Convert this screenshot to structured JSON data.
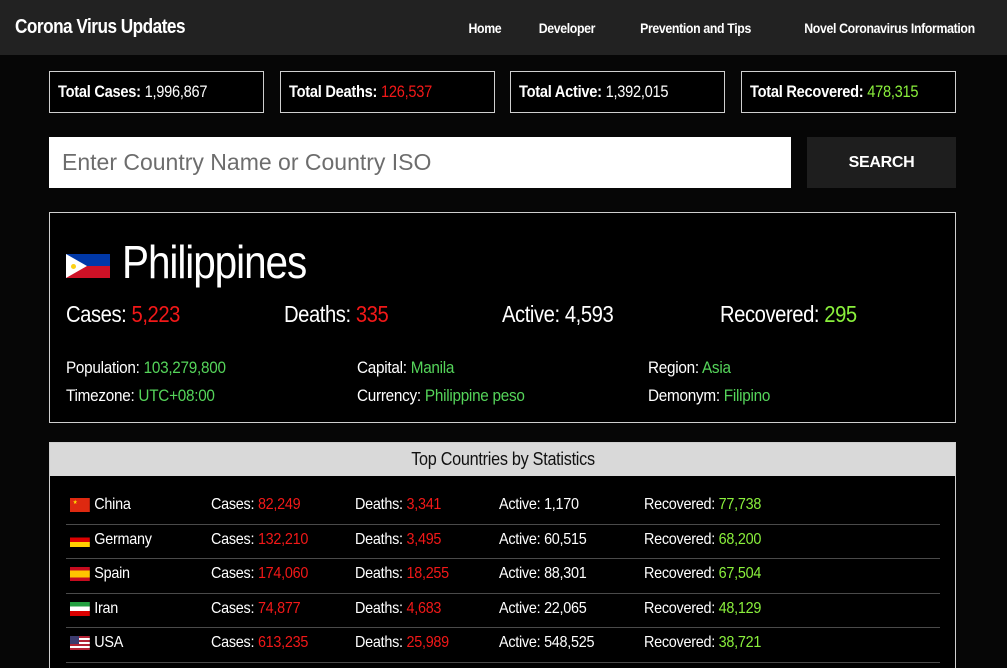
{
  "nav": {
    "brand": "Corona Virus Updates",
    "links": [
      "Home",
      "Developer",
      "Prevention and Tips",
      "Novel Coronavirus Information"
    ]
  },
  "summary": {
    "total_cases_label": "Total Cases:",
    "total_cases": "1,996,867",
    "total_deaths_label": "Total Deaths:",
    "total_deaths": "126,537",
    "total_active_label": "Total Active:",
    "total_active": "1,392,015",
    "total_recovered_label": "Total Recovered:",
    "total_recovered": "478,315"
  },
  "search": {
    "placeholder": "Enter Country Name or Country ISO",
    "button_label": "SEARCH"
  },
  "country": {
    "name": "Philippines",
    "flag_icon": "philippines-flag",
    "cases_label": "Cases:",
    "cases": "5,223",
    "deaths_label": "Deaths:",
    "deaths": "335",
    "active_label": "Active:",
    "active": "4,593",
    "recovered_label": "Recovered:",
    "recovered": "295",
    "population_label": "Population:",
    "population": "103,279,800",
    "capital_label": "Capital:",
    "capital": "Manila",
    "region_label": "Region:",
    "region": "Asia",
    "timezone_label": "Timezone:",
    "timezone": "UTC+08:00",
    "currency_label": "Currency:",
    "currency": "Philippine peso",
    "demonym_label": "Demonym:",
    "demonym": "Filipino"
  },
  "top": {
    "title": "Top Countries by Statistics",
    "cases_label": "Cases:",
    "deaths_label": "Deaths:",
    "active_label": "Active:",
    "recovered_label": "Recovered:",
    "rows": [
      {
        "country": "China",
        "flag_icon": "china-flag",
        "cases": "82,249",
        "deaths": "3,341",
        "active": "1,170",
        "recovered": "77,738"
      },
      {
        "country": "Germany",
        "flag_icon": "germany-flag",
        "cases": "132,210",
        "deaths": "3,495",
        "active": "60,515",
        "recovered": "68,200"
      },
      {
        "country": "Spain",
        "flag_icon": "spain-flag",
        "cases": "174,060",
        "deaths": "18,255",
        "active": "88,301",
        "recovered": "67,504"
      },
      {
        "country": "Iran",
        "flag_icon": "iran-flag",
        "cases": "74,877",
        "deaths": "4,683",
        "active": "22,065",
        "recovered": "48,129"
      },
      {
        "country": "USA",
        "flag_icon": "usa-flag",
        "cases": "613,235",
        "deaths": "25,989",
        "active": "548,525",
        "recovered": "38,721"
      }
    ]
  },
  "colors": {
    "red": "#f21818",
    "green": "#8af03c",
    "info_green": "#55d45a",
    "navbar": "#222222"
  }
}
